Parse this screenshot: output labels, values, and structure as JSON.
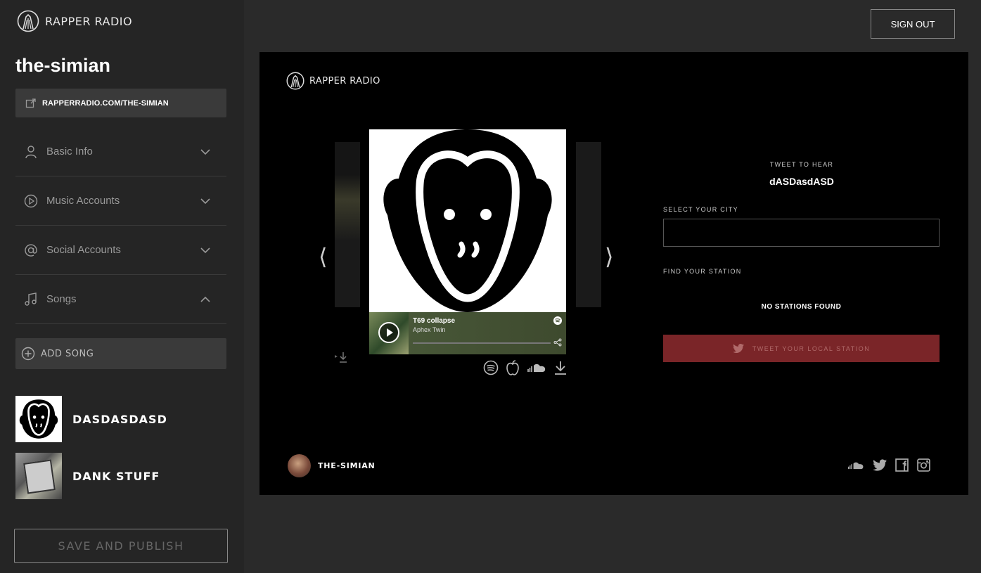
{
  "brand": {
    "name": "RAPPER RADIO"
  },
  "header": {
    "sign_out_label": "SIGN OUT"
  },
  "sidebar": {
    "username": "the-simian",
    "profile_url": "RAPPERRADIO.COM/THE-SIMIAN",
    "sections": [
      {
        "label": "Basic Info",
        "icon": "user-icon",
        "state": "collapsed"
      },
      {
        "label": "Music Accounts",
        "icon": "play-circle-icon",
        "state": "collapsed"
      },
      {
        "label": "Social Accounts",
        "icon": "at-icon",
        "state": "collapsed"
      },
      {
        "label": "Songs",
        "icon": "music-note-icon",
        "state": "expanded"
      }
    ],
    "add_song_label": "ADD SONG",
    "songs": [
      {
        "title": "DASDASDASD"
      },
      {
        "title": "DANK STUFF"
      }
    ],
    "save_label": "SAVE AND PUBLISH"
  },
  "preview": {
    "brand_name": "RAPPER RADIO",
    "player": {
      "track_title": "T69 collapse",
      "artist": "Aphex Twin",
      "progress": 0
    },
    "tweet_to_hear_label": "TWEET TO HEAR",
    "song_name": "dASDasdASD",
    "select_city_label": "SELECT YOUR CITY",
    "city_value": "",
    "find_station_label": "FIND YOUR STATION",
    "no_stations_text": "NO STATIONS FOUND",
    "tweet_button_label": "TWEET YOUR LOCAL STATION",
    "footer_username": "THE-SIMIAN",
    "service_icons": [
      "spotify-icon",
      "apple-icon",
      "soundcloud-icon",
      "download-icon"
    ],
    "social_icons": [
      "soundcloud-icon",
      "twitter-icon",
      "facebook-icon",
      "instagram-icon"
    ]
  },
  "colors": {
    "accent": "#7a2528",
    "background": "#2a2a2a",
    "sidebar": "#252525",
    "preview": "#000000"
  }
}
